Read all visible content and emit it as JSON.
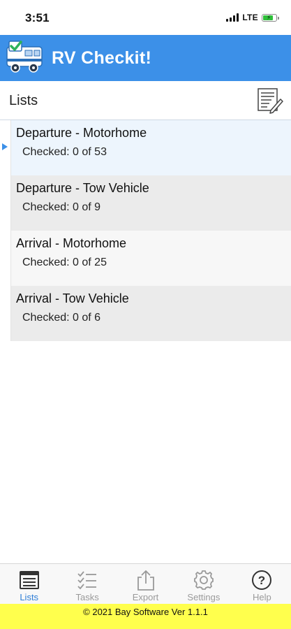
{
  "status_bar": {
    "time": "3:51",
    "network": "LTE",
    "battery_percent": 80
  },
  "header": {
    "title": "RV Checkit!"
  },
  "section": {
    "title": "Lists"
  },
  "lists": [
    {
      "name": "Departure - Motorhome",
      "checked": "Checked: 0 of 53",
      "selected": true
    },
    {
      "name": "Departure - Tow Vehicle",
      "checked": "Checked: 0 of 9",
      "selected": false
    },
    {
      "name": "Arrival - Motorhome",
      "checked": "Checked: 0 of 25",
      "selected": false
    },
    {
      "name": "Arrival - Tow Vehicle",
      "checked": "Checked: 0 of 6",
      "selected": false
    }
  ],
  "tabs": [
    {
      "label": "Lists",
      "icon": "lists-icon",
      "active": true
    },
    {
      "label": "Tasks",
      "icon": "tasks-icon",
      "active": false
    },
    {
      "label": "Export",
      "icon": "export-icon",
      "active": false
    },
    {
      "label": "Settings",
      "icon": "gear-icon",
      "active": false
    },
    {
      "label": "Help",
      "icon": "help-icon",
      "active": false
    }
  ],
  "footer": {
    "text": "© 2021 Bay Software Ver 1.1.1"
  },
  "colors": {
    "header_blue": "#3c90e8",
    "active_tab": "#2e7ed6",
    "inactive_tab": "#9a9a9a",
    "footer_yellow": "#ffff4d",
    "selected_row": "#edf5fd"
  }
}
